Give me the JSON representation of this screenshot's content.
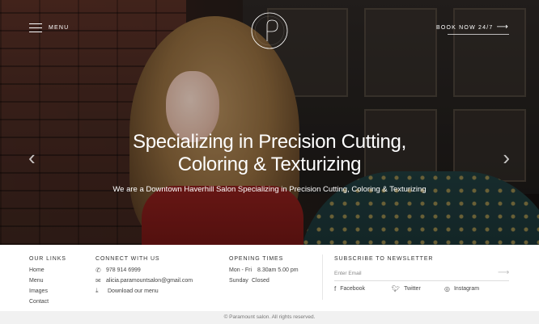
{
  "header": {
    "menu_label": "MENU",
    "book_label": "BOOK NOW 24/7",
    "logo_text": "PARAMOUNT SALON"
  },
  "hero": {
    "headline_line1": "Specializing in Precision Cutting,",
    "headline_line2": "Coloring & Texturizing",
    "subtitle": "We are a Downtown Haverhill Salon Specializing in Precision Cutting, Coloring & Texturizing"
  },
  "footer": {
    "links_title": "OUR LINKS",
    "links": [
      "Home",
      "Menu",
      "Images",
      "Contact"
    ],
    "connect_title": "CONNECT WITH US",
    "phone": "978 914 6999",
    "email": "alicia.paramountsalon@gmail.com",
    "download": "Download our menu",
    "hours_title": "OPENING TIMES",
    "hours_weekday_days": "Mon - Fri",
    "hours_weekday_time": "8.30am  5.00 pm",
    "hours_sunday_day": "Sunday",
    "hours_sunday_value": "Closed",
    "newsletter_title": "SUBSCRIBE TO NEWSLETTER",
    "newsletter_placeholder": "Enter Email",
    "social": [
      "Facebook",
      "Twitter",
      "Instagram"
    ]
  },
  "copyright": "© Paramount salon. All rights reserved.",
  "icons": {
    "menu": "hamburger-icon",
    "book_arrow": "arrow-right-icon",
    "slider_prev": "chevron-left-icon",
    "slider_next": "chevron-right-icon",
    "phone": "phone-icon",
    "email": "envelope-icon",
    "download": "download-icon",
    "submit": "arrow-right-icon",
    "facebook": "facebook-icon",
    "twitter": "twitter-icon",
    "instagram": "instagram-icon"
  }
}
